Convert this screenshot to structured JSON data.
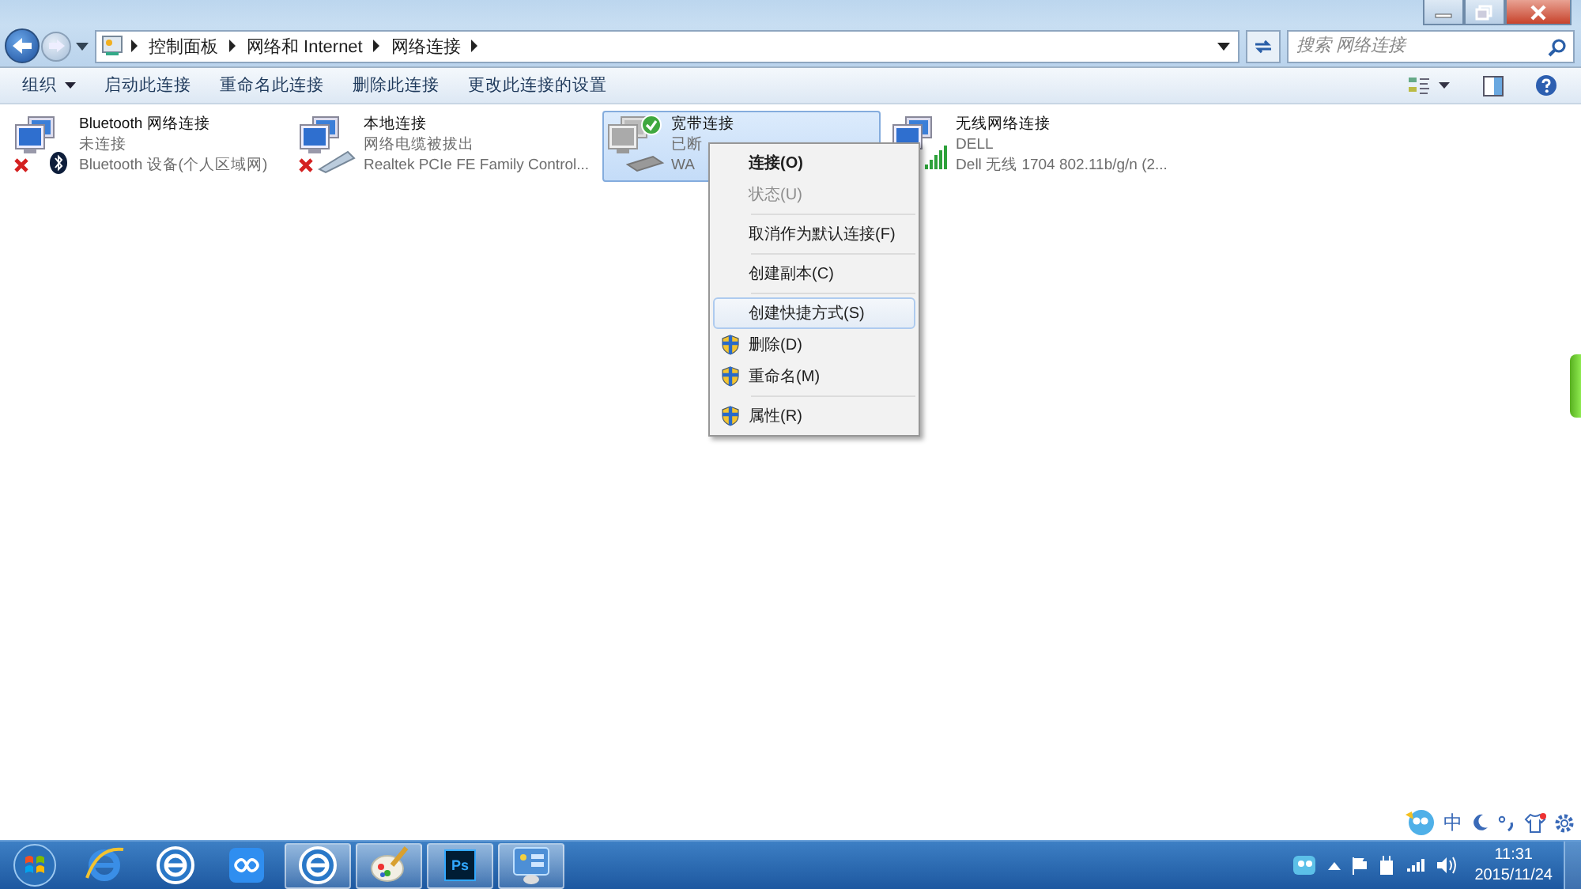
{
  "window": {
    "breadcrumb": [
      "控制面板",
      "网络和 Internet",
      "网络连接"
    ],
    "search": {
      "placeholder": "搜索 网络连接"
    }
  },
  "toolbar": {
    "items": [
      {
        "label": "组织",
        "kind": "menu"
      },
      {
        "label": "启动此连接",
        "kind": "plain"
      },
      {
        "label": "重命名此连接",
        "kind": "plain"
      },
      {
        "label": "删除此连接",
        "kind": "plain"
      },
      {
        "label": "更改此连接的设置",
        "kind": "plain"
      }
    ]
  },
  "connections": [
    {
      "kind": "bluetooth",
      "name": "Bluetooth 网络连接",
      "status": "未连接",
      "device": "Bluetooth 设备(个人区域网)",
      "selected": false
    },
    {
      "kind": "cable",
      "name": "本地连接",
      "status": "网络电缆被拔出",
      "device": "Realtek PCIe FE Family Control...",
      "selected": false
    },
    {
      "kind": "broadband",
      "name": "宽带连接",
      "status": "已断",
      "device": "WA",
      "selected": true
    },
    {
      "kind": "wireless",
      "name": "无线网络连接",
      "status": "DELL",
      "device": "Dell 无线 1704 802.11b/g/n (2...",
      "selected": false
    }
  ],
  "context_menu": {
    "items": [
      {
        "kind": "item",
        "label": "连接(O)",
        "bold": true,
        "disabled": false,
        "shield": false,
        "selected": false
      },
      {
        "kind": "item",
        "label": "状态(U)",
        "bold": false,
        "disabled": true,
        "shield": false,
        "selected": false
      },
      {
        "kind": "separator"
      },
      {
        "kind": "item",
        "label": "取消作为默认连接(F)",
        "bold": false,
        "disabled": false,
        "shield": false,
        "selected": false
      },
      {
        "kind": "separator"
      },
      {
        "kind": "item",
        "label": "创建副本(C)",
        "bold": false,
        "disabled": false,
        "shield": false,
        "selected": false
      },
      {
        "kind": "separator"
      },
      {
        "kind": "item",
        "label": "创建快捷方式(S)",
        "bold": false,
        "disabled": false,
        "shield": false,
        "selected": true
      },
      {
        "kind": "item",
        "label": "删除(D)",
        "bold": false,
        "disabled": false,
        "shield": true,
        "selected": false
      },
      {
        "kind": "item",
        "label": "重命名(M)",
        "bold": false,
        "disabled": false,
        "shield": true,
        "selected": false
      },
      {
        "kind": "separator"
      },
      {
        "kind": "item",
        "label": "属性(R)",
        "bold": false,
        "disabled": false,
        "shield": true,
        "selected": false
      }
    ]
  },
  "ime_bar": {
    "label": "中"
  },
  "taskbar": {
    "apps": [
      {
        "kind": "start",
        "selected": false
      },
      {
        "kind": "ie",
        "selected": false
      },
      {
        "kind": "browser",
        "selected": false
      },
      {
        "kind": "cloud",
        "selected": false
      },
      {
        "kind": "browser",
        "selected": true
      },
      {
        "kind": "paint",
        "selected": true
      },
      {
        "kind": "photoshop",
        "label": "Ps",
        "selected": true
      },
      {
        "kind": "control-panel",
        "selected": true
      }
    ],
    "clock": {
      "time": "11:31",
      "date": "2015/11/24"
    }
  }
}
